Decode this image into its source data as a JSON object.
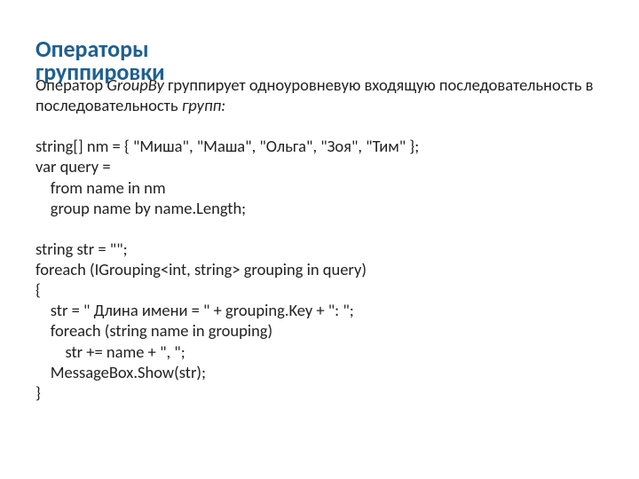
{
  "title_line1": "Операторы",
  "title_line2": "группировки",
  "desc_part1": "Оператор ",
  "desc_part2": "GroupBy",
  "desc_part3": " группирует одноуровневую входящую последовательность в последовательность ",
  "desc_part4": "групп:",
  "code": "string[] nm = { \"Миша\", \"Маша\", \"Ольга\", \"Зоя\", \"Тим\" };\nvar query =\n    from name in nm\n    group name by name.Length;\n\nstring str = \"\";\nforeach (IGrouping<int, string> grouping in query)\n{\n    str = \" Длина имени = \" + grouping.Key + \": \";\n    foreach (string name in grouping)\n        str += name + \", \";\n    MessageBox.Show(str);\n}"
}
